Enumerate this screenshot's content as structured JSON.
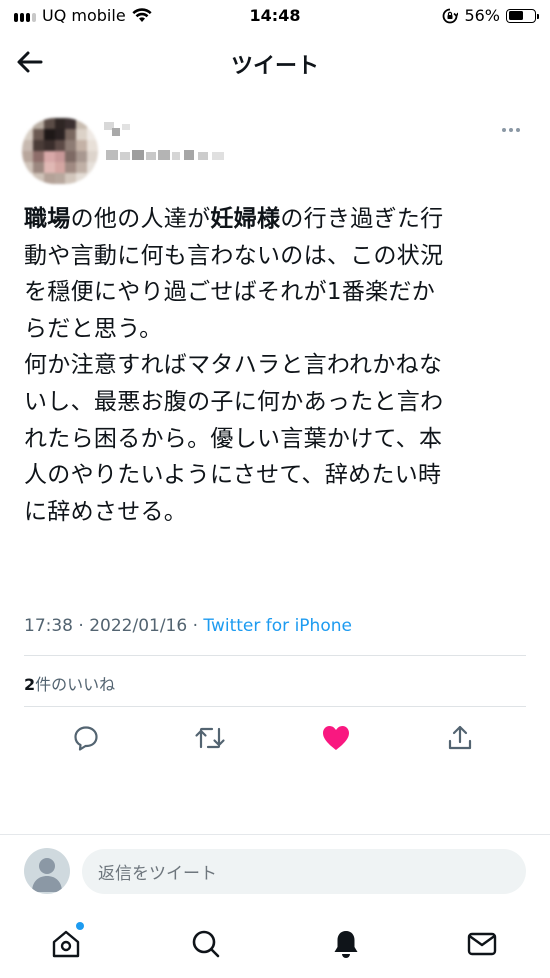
{
  "status_bar": {
    "carrier": "UQ mobile",
    "time": "14:48",
    "battery": "56%",
    "battery_level": 0.56
  },
  "header": {
    "title": "ツイート"
  },
  "tweet": {
    "segments": [
      {
        "text": "職場",
        "bold": true
      },
      {
        "text": "の他の人達が",
        "bold": false
      },
      {
        "text": "妊婦様",
        "bold": true
      },
      {
        "text": "の行き過ぎた行\n動や言動に何も言わないのは、この状況\nを穏便にやり過ごせばそれが1番楽だか\nらだと思う。\n何か注意すればマタハラと言われかねな\nいし、最悪お腹の子に何かあったと言わ\nれたら困るから。優しい言葉かけて、本\n人のやりたいようにさせて、辞めたい時\nに辞めさせる。",
        "bold": false
      }
    ],
    "timestamp": "17:38 · 2022/01/16 · ",
    "source": "Twitter for iPhone",
    "like_count": "2",
    "like_label": "件のいいね"
  },
  "reply": {
    "placeholder": "返信をツイート"
  },
  "colors": {
    "accent": "#1d9bf0",
    "like": "#f91880",
    "secondary_text": "#536471"
  }
}
